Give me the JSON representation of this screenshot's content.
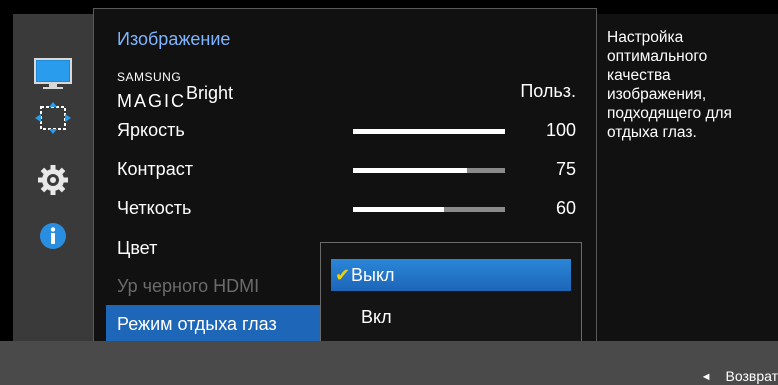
{
  "sidebar": {
    "icons": [
      "monitor-picture-icon",
      "screen-position-icon",
      "gear-icon",
      "info-icon"
    ]
  },
  "menu": {
    "title": "Изображение",
    "items": [
      {
        "label_small": "SAMSUNG",
        "label_big": "MAGIC",
        "label_suffix": "Bright",
        "value": "Польз."
      },
      {
        "label": "Яркость",
        "value": "100",
        "level": 1.0
      },
      {
        "label": "Контраст",
        "value": "75",
        "level": 0.75
      },
      {
        "label": "Четкость",
        "value": "60",
        "level": 0.6
      },
      {
        "label": "Цвет"
      },
      {
        "label": "Ур черного HDMI"
      },
      {
        "label": "Режим отдыха глаз"
      }
    ]
  },
  "submenu": {
    "options": [
      {
        "label": "Выкл",
        "selected": true
      },
      {
        "label": "Вкл",
        "selected": false
      }
    ]
  },
  "help": {
    "text": "Настройка оптимального качества изображения, подходящего для отдыха глаз."
  },
  "footer": {
    "back_label": "Возврат"
  },
  "colors": {
    "highlight": "#1d66b8",
    "title": "#7fb6ff",
    "check": "#f0d000"
  }
}
